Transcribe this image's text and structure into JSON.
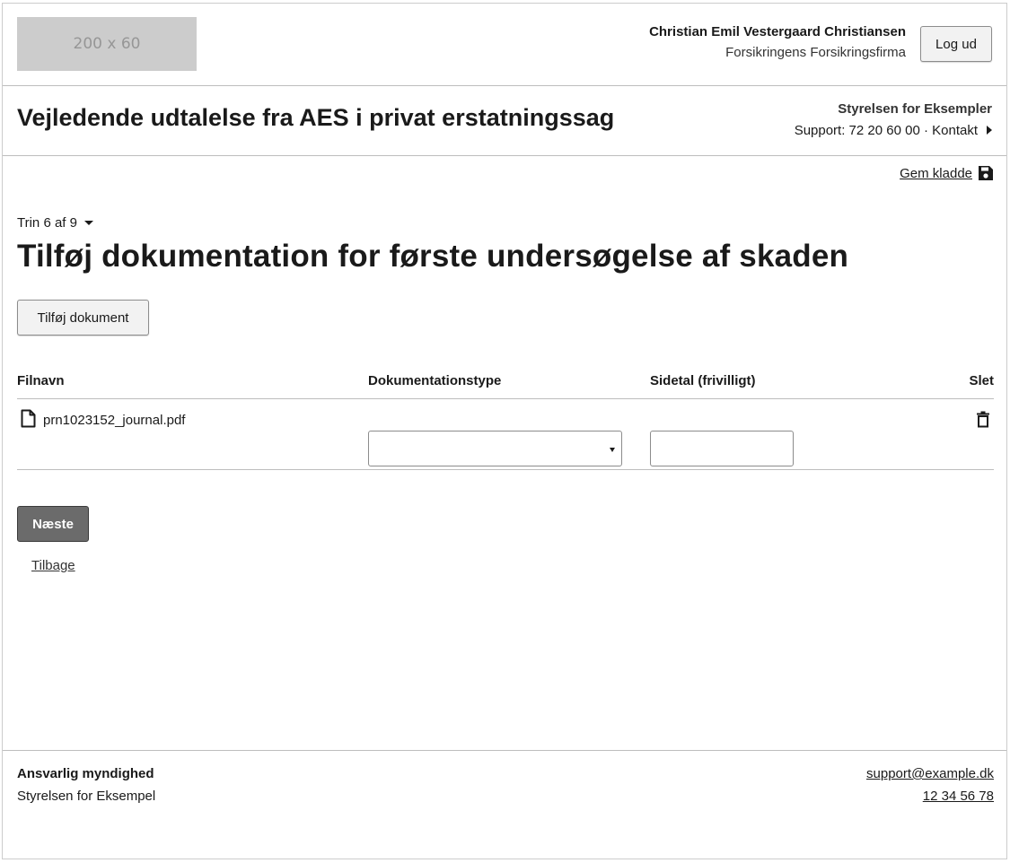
{
  "header": {
    "logo_text": "200 x 60",
    "user_name": "Christian Emil Vestergaard Christiansen",
    "user_org": "Forsikringens Forsikringsfirma",
    "logout_label": "Log ud"
  },
  "service": {
    "title": "Vejledende udtalelse fra AES i privat erstatningssag",
    "authority": "Styrelsen for Eksempler",
    "support_text": "Support: 72 20 60 00 · Kontakt"
  },
  "content": {
    "save_draft_label": "Gem kladde",
    "step_indicator": "Trin 6 af 9",
    "heading": "Tilføj dokumentation for første undersøgelse af skaden",
    "add_document_label": "Tilføj dokument",
    "table": {
      "headers": {
        "filename": "Filnavn",
        "doc_type": "Dokumentationstype",
        "page_number": "Sidetal (frivilligt)",
        "delete": "Slet"
      },
      "rows": [
        {
          "filename": "prn1023152_journal.pdf",
          "doc_type": "",
          "page_number": ""
        }
      ]
    },
    "next_label": "Næste",
    "back_label": "Tilbage"
  },
  "footer": {
    "responsible_label": "Ansvarlig myndighed",
    "authority": "Styrelsen for Eksempel",
    "email": "support@example.dk",
    "phone": "12 34 56 78"
  },
  "colors": {
    "primary_button": "#6b6b6b",
    "border": "#bdbdbd",
    "logo_placeholder": "#cccccc"
  },
  "icons": {
    "save": "floppy-disk-icon",
    "file": "file-icon",
    "delete": "trash-icon",
    "step_toggle": "caret-down-icon",
    "contact": "caret-right-icon"
  }
}
